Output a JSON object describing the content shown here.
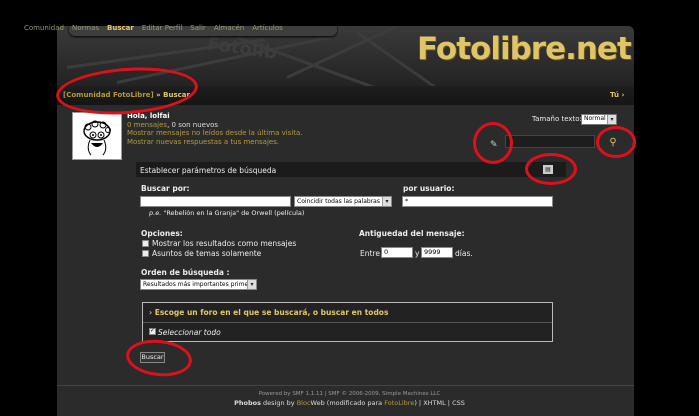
{
  "nav": {
    "items": [
      {
        "label": "Comunidad",
        "active": false
      },
      {
        "label": "Normas",
        "active": false
      },
      {
        "label": "Buscar",
        "active": true
      },
      {
        "label": "Editar Perfil",
        "active": false
      },
      {
        "label": "Salir",
        "active": false
      },
      {
        "label": "Almacén",
        "active": false
      },
      {
        "label": "Artículos",
        "active": false
      }
    ]
  },
  "header": {
    "logo": "Fotolibre.net",
    "ghost_logo": "Fotolib"
  },
  "breadcrumb": {
    "home": "[Comunidad FotoLibre]",
    "sep": " » ",
    "current": "Buscar",
    "user_menu": "Tú"
  },
  "user": {
    "greeting": "Hola, lolfai",
    "messages_link": "0 mensajes",
    "messages_rest": ", 0 son nuevos",
    "unread_link": "Mostrar mensajes no leídos desde la última visita.",
    "replies_link": "Mostrar nuevas respuestas a tus mensajes."
  },
  "text_size": {
    "label": "Tamaño texto:",
    "value": "Normal"
  },
  "search_panel": {
    "title": "Establecer parámetros de búsqueda",
    "search_for_label": "Buscar por:",
    "match_mode": "Coincidir todas las palabras",
    "example_prefix": "p.e.",
    "example_text": "\"Rebelión en la Granja\" de Orwell (película)",
    "by_user_label": "por usuario:",
    "by_user_value": "*",
    "options_label": "Opciones:",
    "opt_show_as_messages": "Mostrar los resultados como mensajes",
    "opt_subjects_only": "Asuntos de temas solamente",
    "age_label": "Antiguedad del mensaje:",
    "between": "Entre",
    "and": "y",
    "min_age": "0",
    "max_age": "9999",
    "days": "días.",
    "order_label": "Orden de búsqueda :",
    "order_value": "Resultados más importantes primero",
    "forum_heading": "Escoge un foro en el que se buscará, o buscar en todos",
    "select_all": "Seleccionar todo",
    "submit": "Buscar"
  },
  "footer": {
    "line1": "Powered by SMF 1.1.11 | SMF © 2006-2009, Simple Machines LLC",
    "theme": "Phobos",
    "design_by": " design by ",
    "bloc": "Bloc",
    "web": "Web",
    "modified": " (modificado para ",
    "fotolibre": "FotoLibre",
    "close": ")",
    "sep1": " | ",
    "xhtml": "XHTML",
    "sep2": " | ",
    "css": "CSS"
  }
}
